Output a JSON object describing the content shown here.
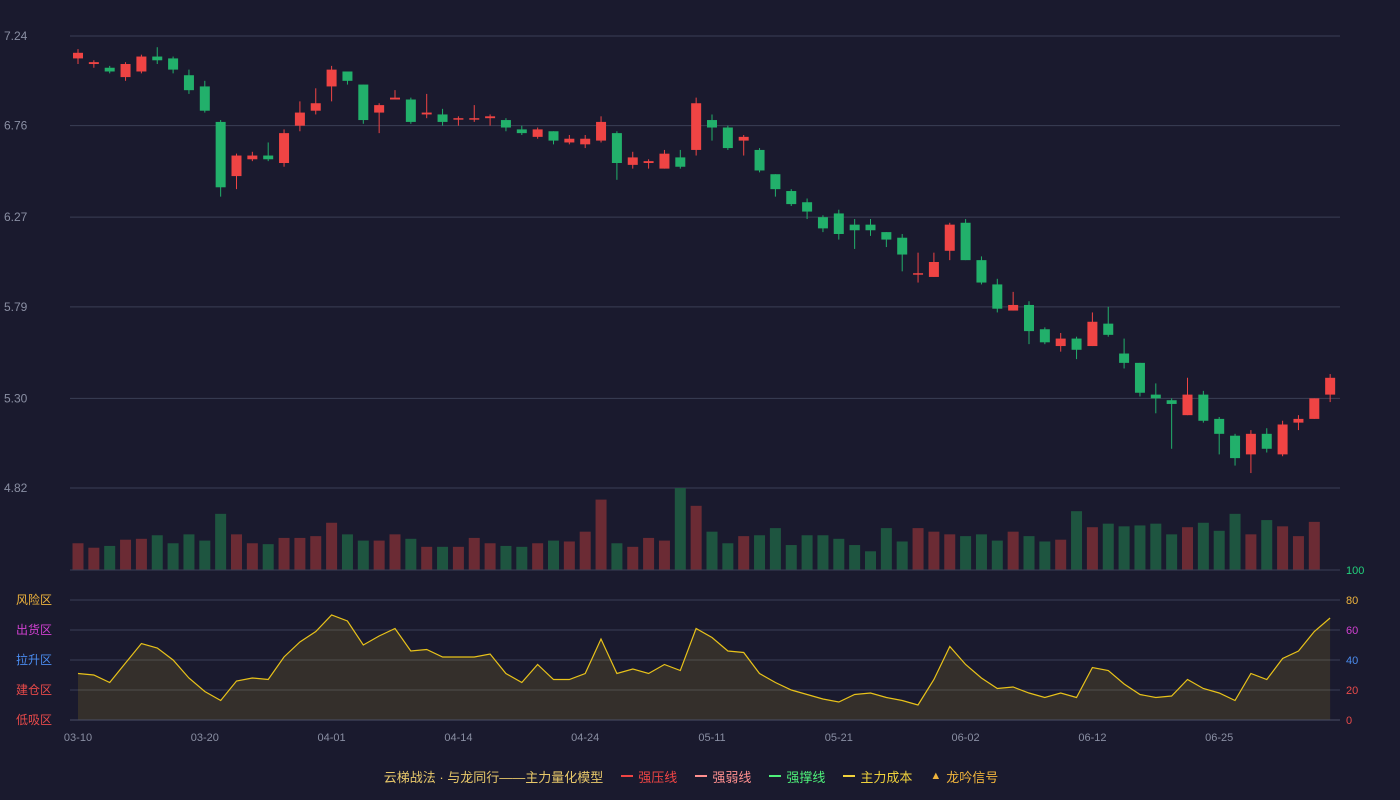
{
  "chart_data": {
    "type": "candlestick",
    "x_tick_labels": [
      "03-10",
      "03-20",
      "04-01",
      "04-14",
      "04-24",
      "05-11",
      "05-21",
      "06-02",
      "06-12",
      "06-25"
    ],
    "x_tick_index": [
      0,
      8,
      16,
      24,
      32,
      40,
      48,
      56,
      64,
      72
    ],
    "price_axis": {
      "ticks": [
        "7.24",
        "6.76",
        "6.27",
        "5.79",
        "5.30",
        "4.82"
      ],
      "ylim": [
        4.82,
        7.24
      ]
    },
    "ohlc": [
      [
        7.12,
        7.15,
        7.09,
        7.17
      ],
      [
        7.09,
        7.1,
        7.07,
        7.11
      ],
      [
        7.07,
        7.05,
        7.04,
        7.08
      ],
      [
        7.02,
        7.09,
        7.0,
        7.1
      ],
      [
        7.05,
        7.13,
        7.04,
        7.14
      ],
      [
        7.13,
        7.11,
        7.09,
        7.18
      ],
      [
        7.12,
        7.06,
        7.04,
        7.13
      ],
      [
        7.03,
        6.95,
        6.93,
        7.06
      ],
      [
        6.97,
        6.84,
        6.83,
        7.0
      ],
      [
        6.78,
        6.43,
        6.38,
        6.79
      ],
      [
        6.49,
        6.6,
        6.42,
        6.61
      ],
      [
        6.58,
        6.6,
        6.57,
        6.62
      ],
      [
        6.6,
        6.58,
        6.57,
        6.67
      ],
      [
        6.56,
        6.72,
        6.54,
        6.74
      ],
      [
        6.76,
        6.83,
        6.73,
        6.89
      ],
      [
        6.84,
        6.88,
        6.82,
        6.96
      ],
      [
        6.97,
        7.06,
        6.89,
        7.08
      ],
      [
        7.05,
        7.0,
        6.98,
        7.05
      ],
      [
        6.98,
        6.79,
        6.77,
        6.98
      ],
      [
        6.83,
        6.87,
        6.72,
        6.88
      ],
      [
        6.9,
        6.91,
        6.9,
        6.95
      ],
      [
        6.9,
        6.78,
        6.77,
        6.91
      ],
      [
        6.82,
        6.83,
        6.8,
        6.93
      ],
      [
        6.82,
        6.78,
        6.76,
        6.85
      ],
      [
        6.8,
        6.8,
        6.76,
        6.81
      ],
      [
        6.8,
        6.8,
        6.78,
        6.87
      ],
      [
        6.8,
        6.81,
        6.76,
        6.82
      ],
      [
        6.79,
        6.75,
        6.73,
        6.8
      ],
      [
        6.74,
        6.72,
        6.71,
        6.76
      ],
      [
        6.7,
        6.74,
        6.69,
        6.75
      ],
      [
        6.73,
        6.68,
        6.66,
        6.73
      ],
      [
        6.67,
        6.69,
        6.66,
        6.71
      ],
      [
        6.66,
        6.69,
        6.64,
        6.71
      ],
      [
        6.68,
        6.78,
        6.67,
        6.81
      ],
      [
        6.72,
        6.56,
        6.47,
        6.73
      ],
      [
        6.55,
        6.59,
        6.53,
        6.62
      ],
      [
        6.56,
        6.57,
        6.53,
        6.58
      ],
      [
        6.53,
        6.61,
        6.53,
        6.63
      ],
      [
        6.59,
        6.54,
        6.53,
        6.63
      ],
      [
        6.63,
        6.88,
        6.6,
        6.91
      ],
      [
        6.79,
        6.75,
        6.68,
        6.82
      ],
      [
        6.75,
        6.64,
        6.63,
        6.76
      ],
      [
        6.68,
        6.7,
        6.6,
        6.71
      ],
      [
        6.63,
        6.52,
        6.51,
        6.64
      ],
      [
        6.5,
        6.42,
        6.38,
        6.5
      ],
      [
        6.41,
        6.34,
        6.33,
        6.42
      ],
      [
        6.35,
        6.3,
        6.26,
        6.37
      ],
      [
        6.27,
        6.21,
        6.19,
        6.28
      ],
      [
        6.29,
        6.18,
        6.15,
        6.31
      ],
      [
        6.23,
        6.2,
        6.1,
        6.26
      ],
      [
        6.23,
        6.2,
        6.17,
        6.26
      ],
      [
        6.19,
        6.15,
        6.11,
        6.19
      ],
      [
        6.16,
        6.07,
        5.98,
        6.18
      ],
      [
        5.97,
        5.97,
        5.92,
        6.08
      ],
      [
        5.95,
        6.03,
        5.95,
        6.08
      ],
      [
        6.09,
        6.23,
        6.04,
        6.24
      ],
      [
        6.24,
        6.04,
        6.04,
        6.26
      ],
      [
        6.04,
        5.92,
        5.91,
        6.06
      ],
      [
        5.91,
        5.78,
        5.76,
        5.94
      ],
      [
        5.77,
        5.8,
        5.77,
        5.87
      ],
      [
        5.8,
        5.66,
        5.59,
        5.82
      ],
      [
        5.67,
        5.6,
        5.59,
        5.68
      ],
      [
        5.58,
        5.62,
        5.55,
        5.65
      ],
      [
        5.62,
        5.56,
        5.51,
        5.63
      ],
      [
        5.58,
        5.71,
        5.58,
        5.76
      ],
      [
        5.7,
        5.64,
        5.63,
        5.79
      ],
      [
        5.54,
        5.49,
        5.46,
        5.62
      ],
      [
        5.49,
        5.33,
        5.31,
        5.49
      ],
      [
        5.32,
        5.3,
        5.22,
        5.38
      ],
      [
        5.29,
        5.27,
        5.03,
        5.3
      ],
      [
        5.21,
        5.32,
        5.21,
        5.41
      ],
      [
        5.32,
        5.18,
        5.17,
        5.34
      ],
      [
        5.19,
        5.11,
        5.0,
        5.2
      ],
      [
        5.1,
        4.98,
        4.94,
        5.11
      ],
      [
        5.0,
        5.11,
        4.9,
        5.13
      ],
      [
        5.11,
        5.03,
        5.01,
        5.14
      ],
      [
        5.0,
        5.16,
        4.99,
        5.18
      ],
      [
        5.17,
        5.19,
        5.13,
        5.21
      ],
      [
        5.19,
        5.3,
        5.19,
        5.3
      ],
      [
        5.32,
        5.41,
        5.28,
        5.43
      ]
    ],
    "volume": [
      30,
      25,
      27,
      34,
      35,
      39,
      30,
      40,
      33,
      63,
      40,
      30,
      29,
      36,
      36,
      38,
      53,
      40,
      33,
      33,
      40,
      35,
      26,
      26,
      26,
      36,
      30,
      27,
      26,
      30,
      33,
      32,
      43,
      79,
      30,
      26,
      36,
      33,
      92,
      72,
      43,
      30,
      38,
      39,
      47,
      28,
      39,
      39,
      35,
      28,
      21,
      47,
      32,
      47,
      43,
      40,
      38,
      40,
      33,
      43,
      38,
      32,
      34,
      66,
      48,
      52,
      49,
      50,
      52,
      40,
      48,
      53,
      44,
      63,
      40,
      56,
      49,
      38,
      54
    ],
    "volume_colors": {
      "up": "#6b2b34",
      "down": "#1e5540"
    },
    "indicator": {
      "zones": [
        "风险区",
        "出货区",
        "拉升区",
        "建仓区",
        "低吸区"
      ],
      "zone_colors": [
        "#f0b43c",
        "#d040d0",
        "#4a8cf0",
        "#e84a4a",
        "#e84a4a"
      ],
      "right_ticks": [
        "100",
        "80",
        "60",
        "40",
        "20",
        "0"
      ],
      "right_tick_colors": [
        "#22d07c",
        "#f0b43c",
        "#d040d0",
        "#4a8cf0",
        "#e84a4a",
        "#e84a4a"
      ],
      "ylim": [
        0,
        100
      ],
      "values": [
        31,
        30,
        25,
        38,
        51,
        48,
        40,
        28,
        19,
        13,
        26,
        28,
        27,
        42,
        52,
        59,
        70,
        66,
        50,
        56,
        61,
        46,
        47,
        42,
        42,
        42,
        44,
        31,
        25,
        37,
        27,
        27,
        31,
        54,
        31,
        34,
        31,
        37,
        33,
        61,
        55,
        46,
        45,
        31,
        25,
        20,
        17,
        14,
        12,
        17,
        18,
        15,
        13,
        10,
        27,
        49,
        37,
        28,
        21,
        22,
        18,
        15,
        18,
        15,
        35,
        33,
        24,
        17,
        15,
        16,
        27,
        21,
        18,
        13,
        31,
        27,
        41,
        46,
        59,
        68
      ],
      "line_color": "#e8c21a"
    },
    "colors": {
      "up": "#ef4444",
      "down": "#22b06b",
      "grid": "#3a3f55",
      "axis_text": "#8a8fa3"
    }
  },
  "legend": {
    "title": "云梯战法 · 与龙同行——主力量化模型",
    "title_color": "#e8c86a",
    "items": [
      {
        "label": "强压线",
        "color": "#ef4444",
        "style": "solid"
      },
      {
        "label": "强弱线",
        "color": "#ff8f8f",
        "style": "dashed"
      },
      {
        "label": "强撑线",
        "color": "#4ef07a",
        "style": "solid"
      },
      {
        "label": "主力成本",
        "color": "#f0d23c",
        "style": "dashed"
      },
      {
        "label": "龙吟信号",
        "color": "#f0b43c",
        "style": "triangle"
      }
    ]
  }
}
